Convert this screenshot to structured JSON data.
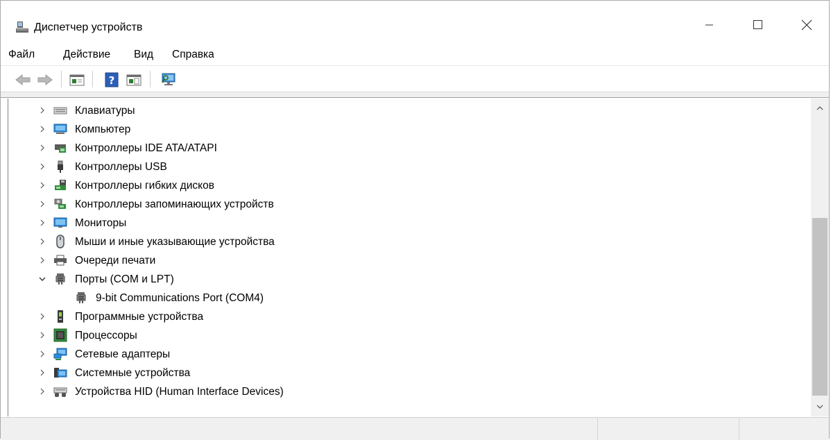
{
  "window": {
    "title": "Диспетчер устройств",
    "controls": {
      "minimize_icon": "minimize-icon",
      "maximize_icon": "maximize-icon",
      "close_icon": "close-icon"
    }
  },
  "menu": {
    "items": [
      {
        "label": "Файл"
      },
      {
        "label": "Действие"
      },
      {
        "label": "Вид"
      },
      {
        "label": "Справка"
      }
    ]
  },
  "toolbar": {
    "buttons": [
      "back-icon",
      "forward-icon",
      "properties-icon",
      "help-icon",
      "update-driver-icon",
      "scan-hardware-icon"
    ]
  },
  "tree": {
    "items": [
      {
        "label": "Клавиатуры",
        "expanded": false,
        "icon": "keyboard-icon"
      },
      {
        "label": "Компьютер",
        "expanded": false,
        "icon": "computer-icon"
      },
      {
        "label": "Контроллеры IDE ATA/ATAPI",
        "expanded": false,
        "icon": "ide-controller-icon"
      },
      {
        "label": "Контроллеры USB",
        "expanded": false,
        "icon": "usb-icon"
      },
      {
        "label": "Контроллеры гибких дисков",
        "expanded": false,
        "icon": "floppy-controller-icon"
      },
      {
        "label": "Контроллеры запоминающих устройств",
        "expanded": false,
        "icon": "storage-controller-icon"
      },
      {
        "label": "Мониторы",
        "expanded": false,
        "icon": "monitor-icon"
      },
      {
        "label": "Мыши и иные указывающие устройства",
        "expanded": false,
        "icon": "mouse-icon"
      },
      {
        "label": "Очереди печати",
        "expanded": false,
        "icon": "printer-icon"
      },
      {
        "label": "Порты (COM и LPT)",
        "expanded": true,
        "icon": "port-icon"
      },
      {
        "label": "9-bit Communications Port (COM4)",
        "child": true,
        "icon": "port-icon"
      },
      {
        "label": "Программные устройства",
        "expanded": false,
        "icon": "software-device-icon"
      },
      {
        "label": "Процессоры",
        "expanded": false,
        "icon": "processor-icon"
      },
      {
        "label": "Сетевые адаптеры",
        "expanded": false,
        "icon": "network-adapter-icon"
      },
      {
        "label": "Системные устройства",
        "expanded": false,
        "icon": "system-device-icon"
      },
      {
        "label": "Устройства HID (Human Interface Devices)",
        "expanded": false,
        "icon": "hid-icon"
      }
    ]
  },
  "colors": {
    "accent": "#1e6fd9",
    "statusbar": "#f0f0f0",
    "scroll_thumb": "#c2c2c2"
  }
}
